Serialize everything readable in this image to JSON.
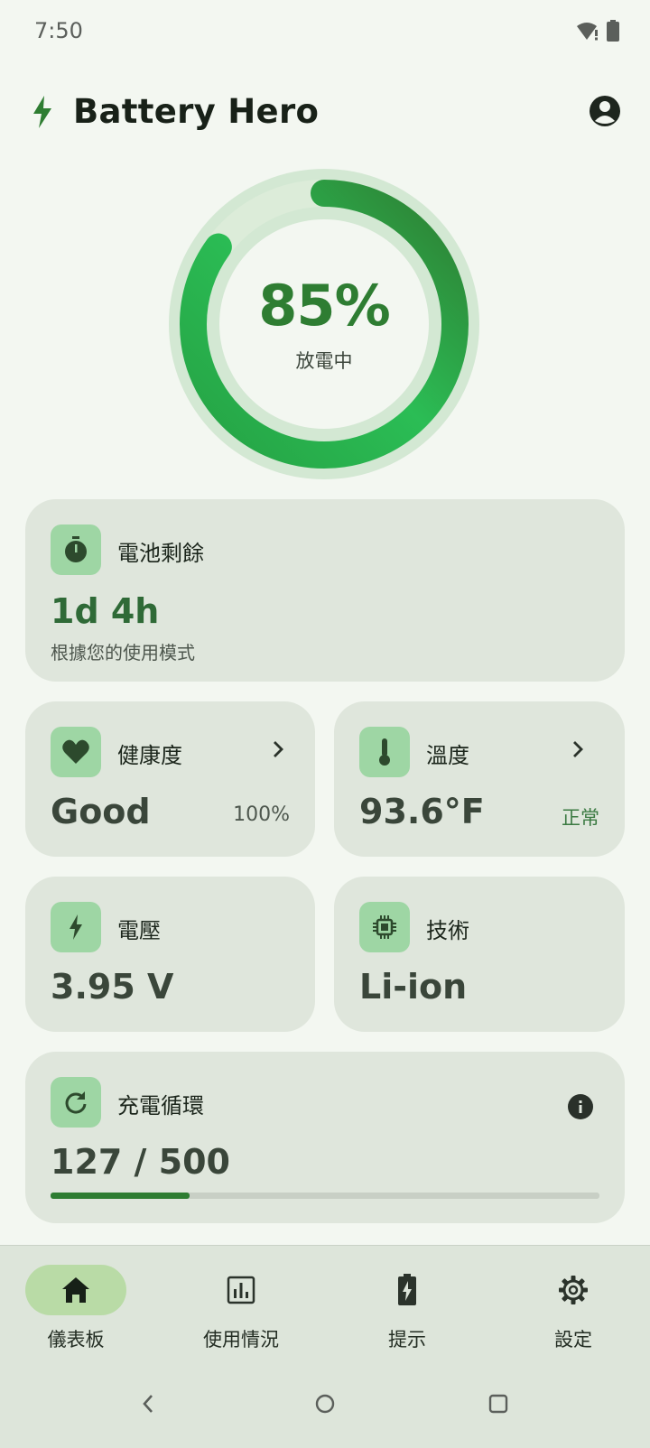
{
  "status_bar": {
    "time": "7:50",
    "icons": [
      "wifi-alert-icon",
      "battery-icon"
    ]
  },
  "app_bar": {
    "title": "Battery Hero",
    "logo_icon": "bolt-icon",
    "action_icon": "account-circle-icon"
  },
  "gauge": {
    "percent_text": "85%",
    "percent_value": 85,
    "status": "放電中",
    "color": "#2e7d32"
  },
  "cards": {
    "remaining": {
      "icon": "timer-icon",
      "label": "電池剩餘",
      "value": "1d 4h",
      "note": "根據您的使用模式"
    },
    "health": {
      "icon": "heart-icon",
      "label": "健康度",
      "value": "Good",
      "meta": "100%"
    },
    "temperature": {
      "icon": "thermometer-icon",
      "label": "溫度",
      "value": "93.6°F",
      "meta": "正常"
    },
    "voltage": {
      "icon": "bolt-icon",
      "label": "電壓",
      "value": "3.95 V"
    },
    "technology": {
      "icon": "chip-icon",
      "label": "技術",
      "value": "Li-ion"
    },
    "cycles": {
      "icon": "refresh-icon",
      "label": "充電循環",
      "value": "127 / 500",
      "progress": 0.254
    }
  },
  "bottom_nav": {
    "items": [
      {
        "label": "儀表板",
        "icon": "home-icon",
        "active": true
      },
      {
        "label": "使用情況",
        "icon": "bar-chart-icon",
        "active": false
      },
      {
        "label": "提示",
        "icon": "battery-charging-icon",
        "active": false
      },
      {
        "label": "設定",
        "icon": "gear-icon",
        "active": false
      }
    ]
  },
  "colors": {
    "accent": "#2e7d32",
    "card_bg": "#dfe6dc",
    "icon_tile": "#9ed6a4",
    "page_bg": "#f3f7f1"
  }
}
